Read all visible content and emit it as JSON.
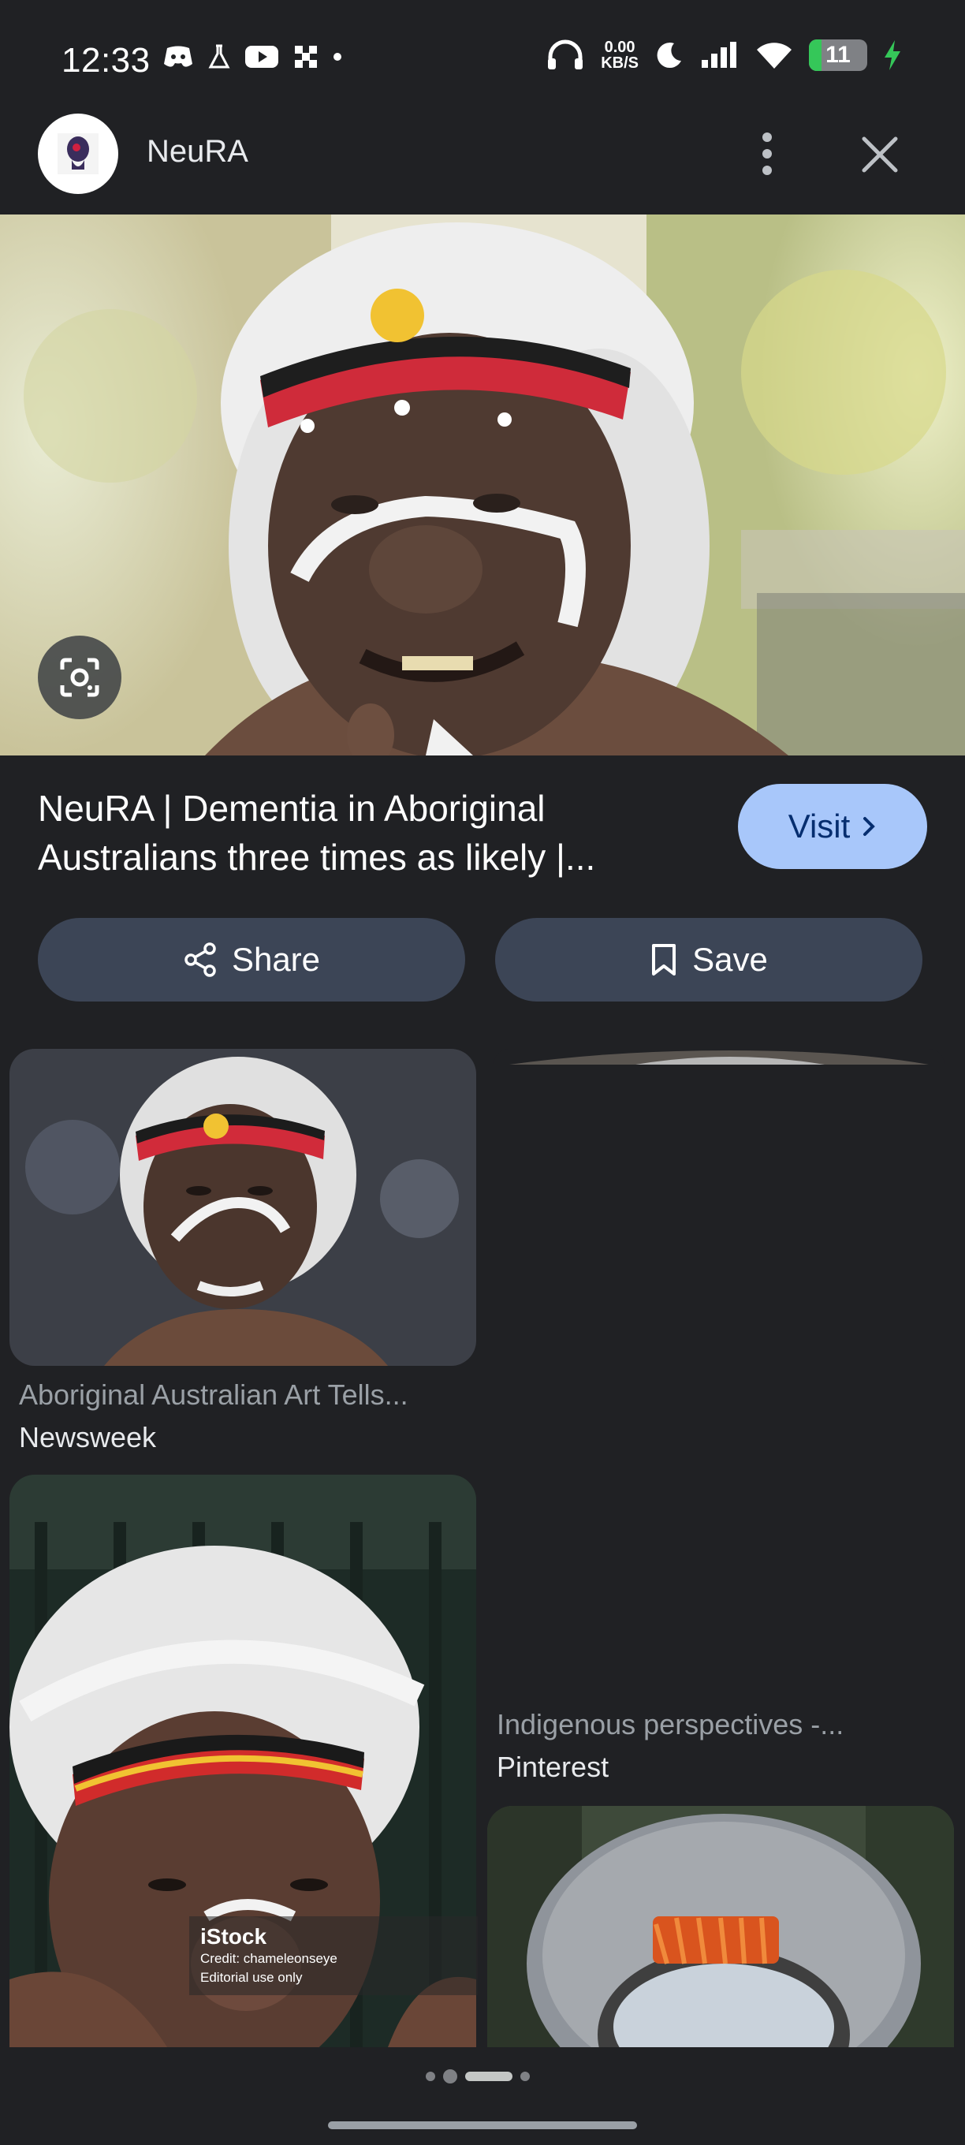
{
  "status_bar": {
    "time": "12:33",
    "net_speed_value": "0.00",
    "net_speed_unit": "KB/S",
    "battery_level": "11",
    "icons": [
      "discord-icon",
      "lab-flask-icon",
      "youtube-icon",
      "grid-app-icon",
      "dot-icon",
      "headphones-icon",
      "moon-icon",
      "signal-icon",
      "wifi-icon",
      "battery-icon",
      "charging-bolt-icon"
    ]
  },
  "header": {
    "site_name": "NeuRA",
    "icons": [
      "more-vert-icon",
      "close-icon"
    ]
  },
  "hero": {
    "title": "NeuRA | Dementia in Aboriginal Australians three times as likely |...",
    "visit_label": "Visit"
  },
  "actions": {
    "share_label": "Share",
    "save_label": "Save"
  },
  "results": [
    {
      "title": "Aboriginal Australian Art Tells...",
      "source": "Newsweek"
    },
    {
      "title": "Indigenous perspectives -...",
      "source": "Pinterest"
    }
  ],
  "watermark": {
    "brand": "iStock",
    "credit": "Credit: chameleonseye",
    "note": "Editorial use only"
  },
  "colors": {
    "background": "#202124",
    "visit_button": "#a8c7fa",
    "pill_button": "#3c4556",
    "battery_fill": "#35c759"
  }
}
